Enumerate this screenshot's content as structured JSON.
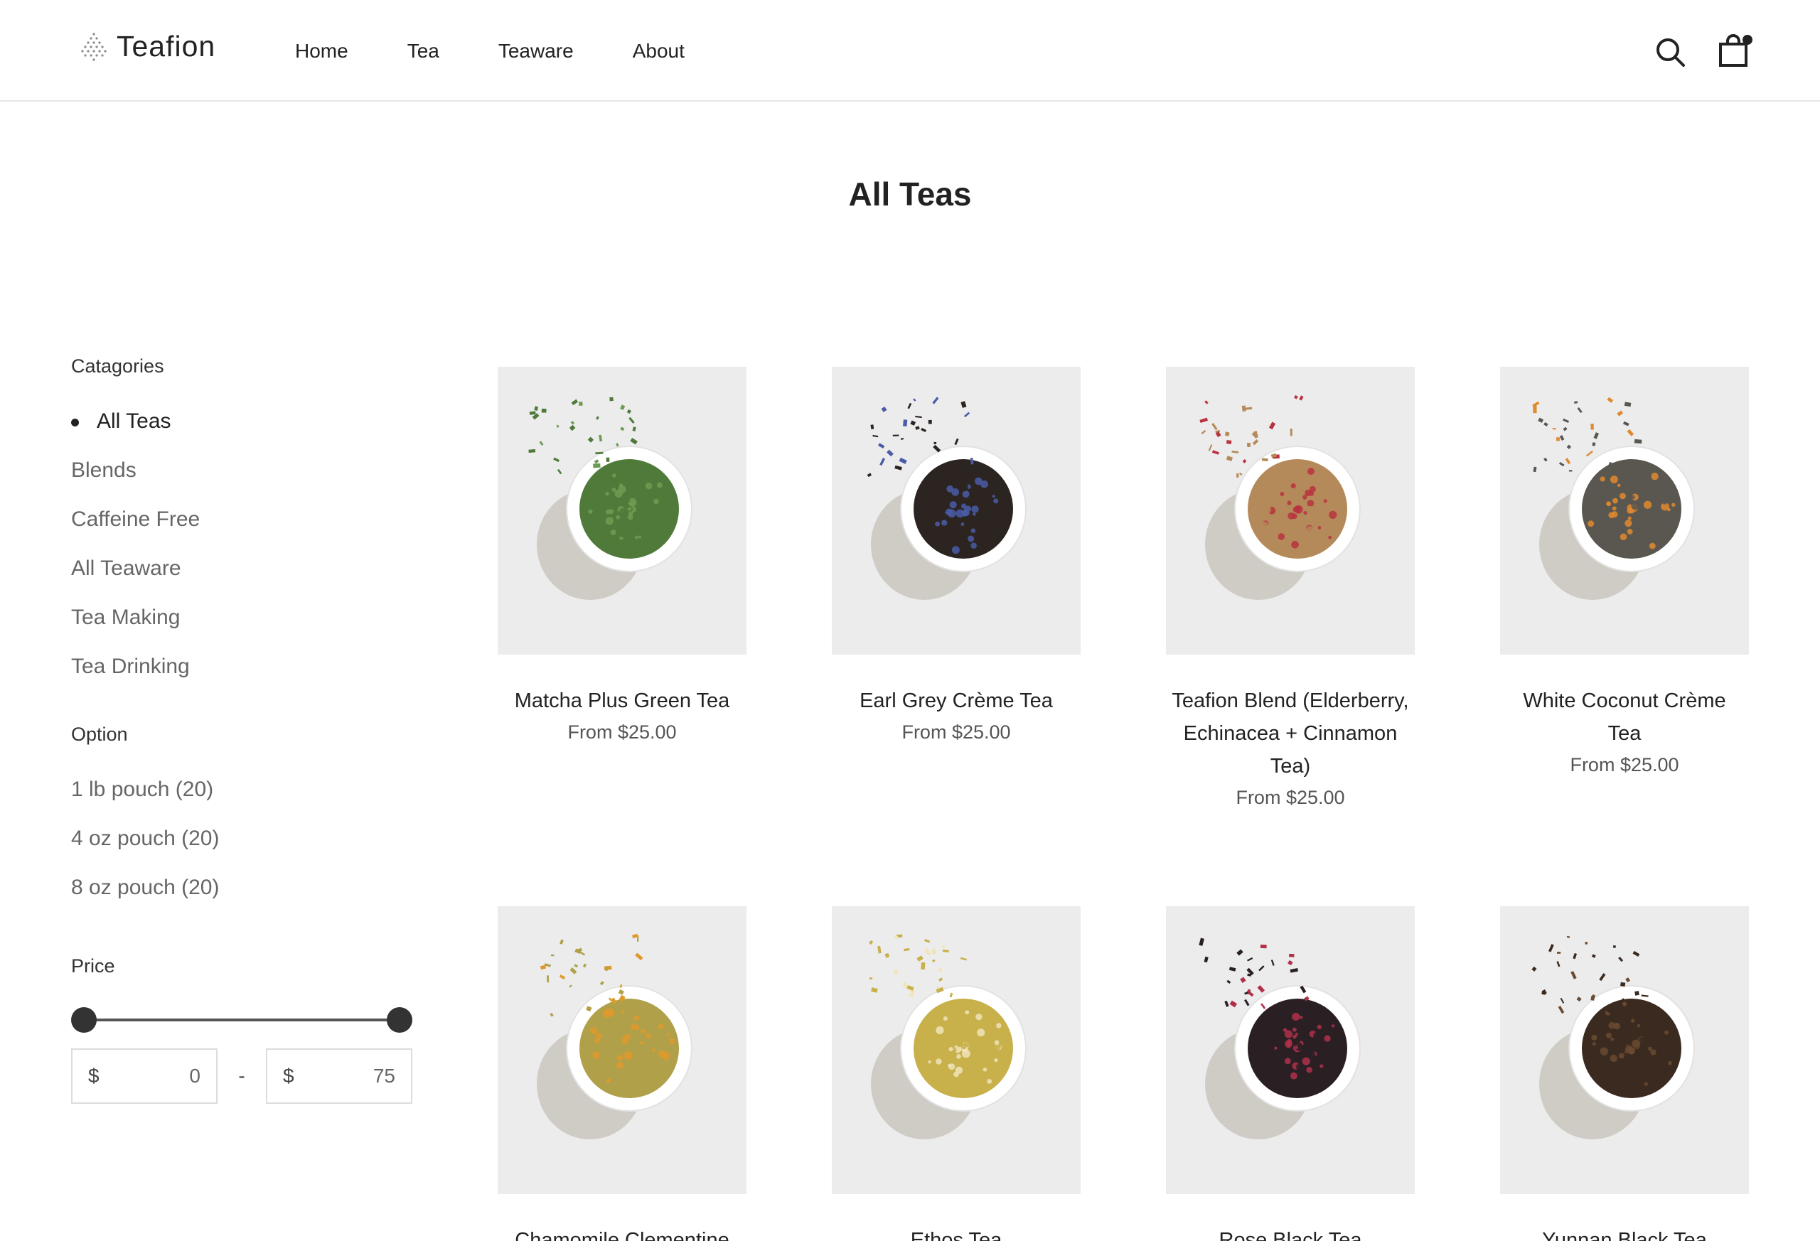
{
  "brand": {
    "name": "Teafion"
  },
  "nav": [
    "Home",
    "Tea",
    "Teaware",
    "About"
  ],
  "page": {
    "title": "All Teas"
  },
  "sidebar": {
    "categories_heading": "Catagories",
    "categories": [
      "All Teas",
      "Blends",
      "Caffeine Free",
      "All Teaware",
      "Tea Making",
      "Tea Drinking"
    ],
    "active_category": "All Teas",
    "option_heading": "Option",
    "options": [
      "1 lb pouch (20)",
      "4 oz pouch (20)",
      "8 oz pouch (20)"
    ],
    "price_heading": "Price",
    "price_min": {
      "currency": "$",
      "value": "0"
    },
    "price_separator": "-",
    "price_max": {
      "currency": "$",
      "value": "75"
    },
    "price_slider": {
      "min": 0,
      "max": 75
    }
  },
  "products": [
    {
      "name": "Matcha Plus Green Tea",
      "price": "From $25.00",
      "leaf_color": "#4f7a3a",
      "accent_color": "#6e9b52"
    },
    {
      "name": "Earl Grey Crème Tea",
      "price": "From $25.00",
      "leaf_color": "#2b2420",
      "accent_color": "#4a5ca8"
    },
    {
      "name": "Teafion Blend (Elderberry, Echinacea + Cinnamon Tea)",
      "price": "From $25.00",
      "leaf_color": "#b58a5a",
      "accent_color": "#b8323f"
    },
    {
      "name": "White Coconut Crème Tea",
      "price": "From $25.00",
      "leaf_color": "#5a5650",
      "accent_color": "#e08a2e"
    },
    {
      "name": "Chamomile Clementine",
      "price": "",
      "leaf_color": "#b0a04a",
      "accent_color": "#e09a2a"
    },
    {
      "name": "Ethos Tea",
      "price": "",
      "leaf_color": "#c8b04a",
      "accent_color": "#f0e4b8"
    },
    {
      "name": "Rose Black Tea",
      "price": "",
      "leaf_color": "#2a2024",
      "accent_color": "#b0304a"
    },
    {
      "name": "Yunnan Black Tea",
      "price": "",
      "leaf_color": "#3a2a20",
      "accent_color": "#6a4a30"
    }
  ]
}
